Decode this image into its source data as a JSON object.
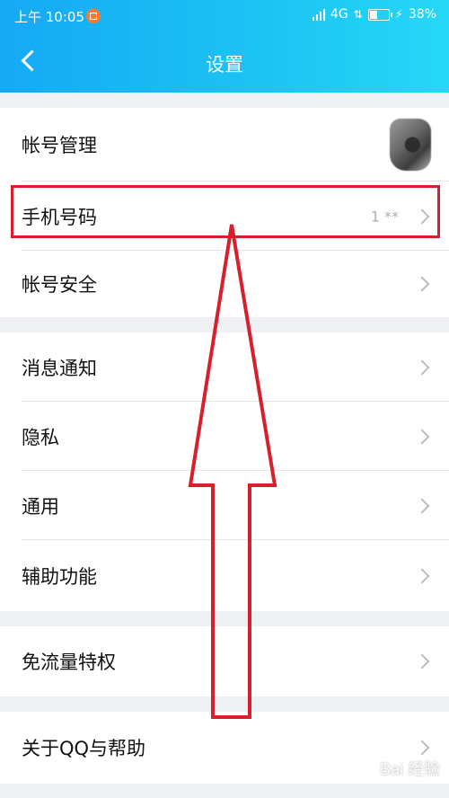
{
  "status_bar": {
    "time": "上午 10:05",
    "network": "4G",
    "battery": "38%"
  },
  "header": {
    "title": "设置"
  },
  "settings": {
    "account_manage": "帐号管理",
    "phone_number": "手机号码",
    "phone_value": "1   **",
    "account_security": "帐号安全",
    "notifications": "消息通知",
    "privacy": "隐私",
    "general": "通用",
    "accessibility": "辅助功能",
    "free_traffic": "免流量特权",
    "about_help": "关于QQ与帮助"
  },
  "annotation_color": "#d8202c",
  "watermark": "Bai 经验"
}
